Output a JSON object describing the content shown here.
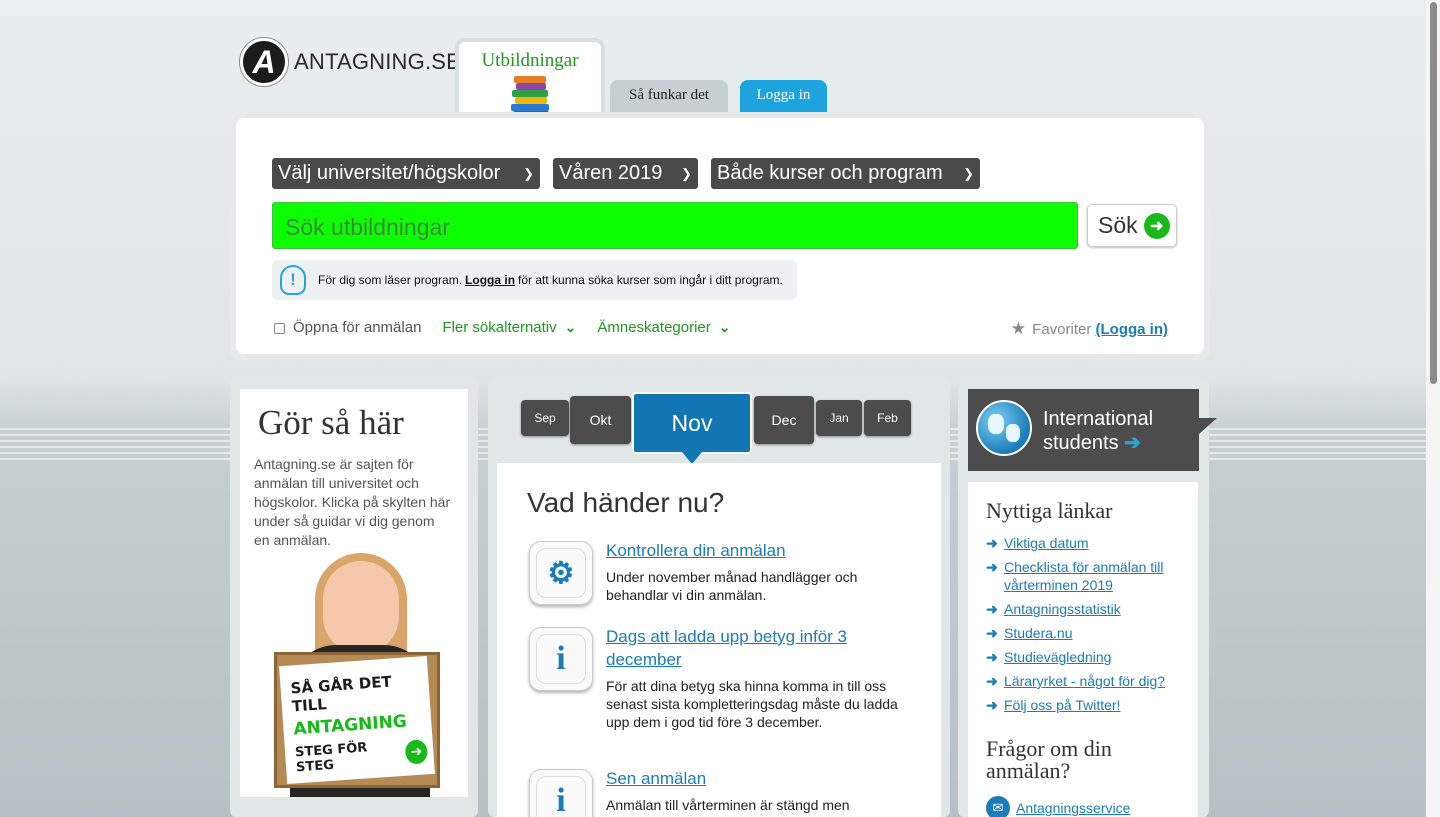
{
  "brand": {
    "logo_letter": "A",
    "name": "ANTAGNING.SE"
  },
  "tabs": [
    {
      "label": "Utbildningar",
      "active": true
    },
    {
      "label": "Så funkar det",
      "active": false
    },
    {
      "label": "Logga in",
      "active": false
    }
  ],
  "search": {
    "university_select": "Välj universitet/högskolor",
    "term_select": "Våren 2019",
    "type_select": "Både kurser och program",
    "placeholder": "Sök utbildningar",
    "button_label": "Sök",
    "info_before": "För dig som läser program.",
    "info_link": "Logga in",
    "info_after": "för att kunna söka kurser som ingår i ditt program.",
    "open_checkbox_label": "Öppna för anmälan",
    "more_options": "Fler sökalternativ",
    "subject_categories": "Ämneskategorier",
    "favorites_label": "Favoriter",
    "favorites_login": "(Logga in)"
  },
  "guide": {
    "title": "Gör så här",
    "text": "Antagning.se är sajten för anmälan till universitet och högskolor. Klicka på skylten här under så guidar vi dig genom en anmälan.",
    "sign_line1": "SÅ GÅR DET TILL",
    "sign_line2": "ANTAGNING",
    "sign_line3": "STEG FÖR STEG"
  },
  "months": [
    "Sep",
    "Okt",
    "Nov",
    "Dec",
    "Jan",
    "Feb"
  ],
  "active_month": "Nov",
  "whats_next": {
    "title": "Vad händer nu?",
    "items": [
      {
        "title": "Kontrollera din anmälan",
        "text": "Under november månad handlägger och behandlar vi din anmälan.",
        "icon": "gears-icon"
      },
      {
        "title": "Dags att ladda upp betyg inför 3 december",
        "text": "För att dina betyg ska hinna komma in till oss senast sista kompletteringsdag måste du ladda upp dem i god tid före 3 december.",
        "icon": "info-icon"
      },
      {
        "title": "Sen anmälan",
        "text": "Anmälan till vårterminen är stängd men",
        "icon": "info-icon"
      }
    ]
  },
  "international": {
    "line1": "International",
    "line2": "students",
    "arrow": "➔"
  },
  "useful_links": {
    "title": "Nyttiga länkar",
    "items": [
      "Viktiga datum",
      "Checklista för anmälan till vårterminen 2019",
      "Antagningsstatistik",
      "Studera.nu",
      "Studievägledning",
      "Läraryrket - något för dig?",
      "Följ oss på Twitter!"
    ]
  },
  "questions": {
    "title": "Frågor om din anmälan?",
    "service_link": "Antagningsservice"
  },
  "colors": {
    "search_field": "#0dfe00",
    "accent_blue": "#1376b4",
    "link_blue": "#1a7cb8",
    "green": "#1f9a1f",
    "dark_gray": "#4c4c4c"
  }
}
